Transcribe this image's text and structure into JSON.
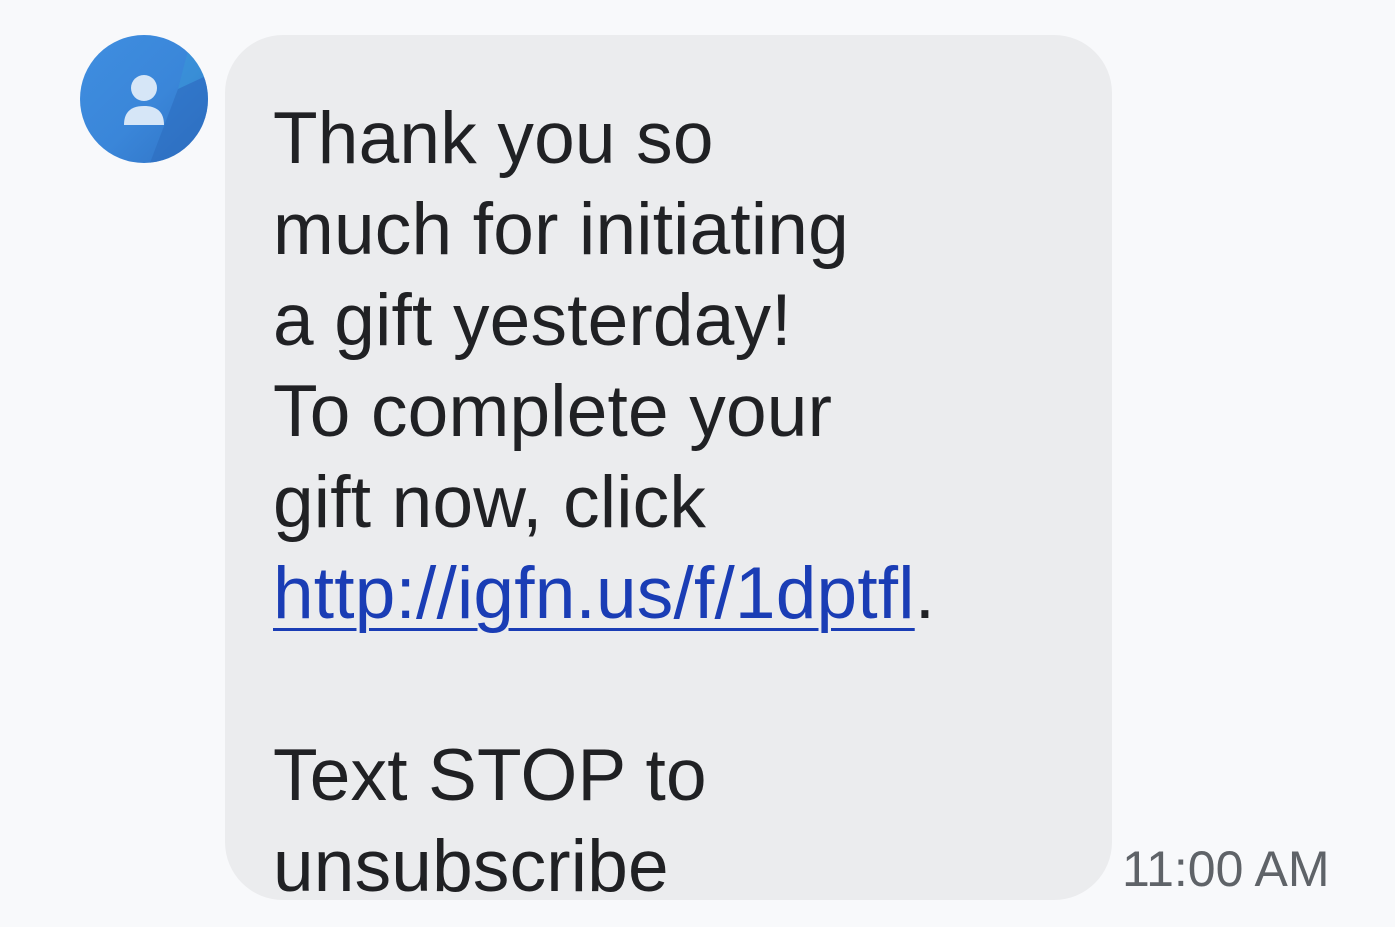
{
  "sender": {
    "avatar_icon": "person-icon",
    "avatar_color": "#3b87db"
  },
  "message": {
    "lines": [
      "Thank you so",
      "much for initiating",
      "a gift yesterday!",
      "To complete your",
      "gift now, click"
    ],
    "link_text": "http://igfn.us/f/1dptfl",
    "link_suffix": ".",
    "footer_lines": [
      "Text STOP to",
      "unsubscribe"
    ],
    "bubble_color": "#ebecee",
    "link_color": "#1a3db5"
  },
  "timestamp": "11:00 AM"
}
